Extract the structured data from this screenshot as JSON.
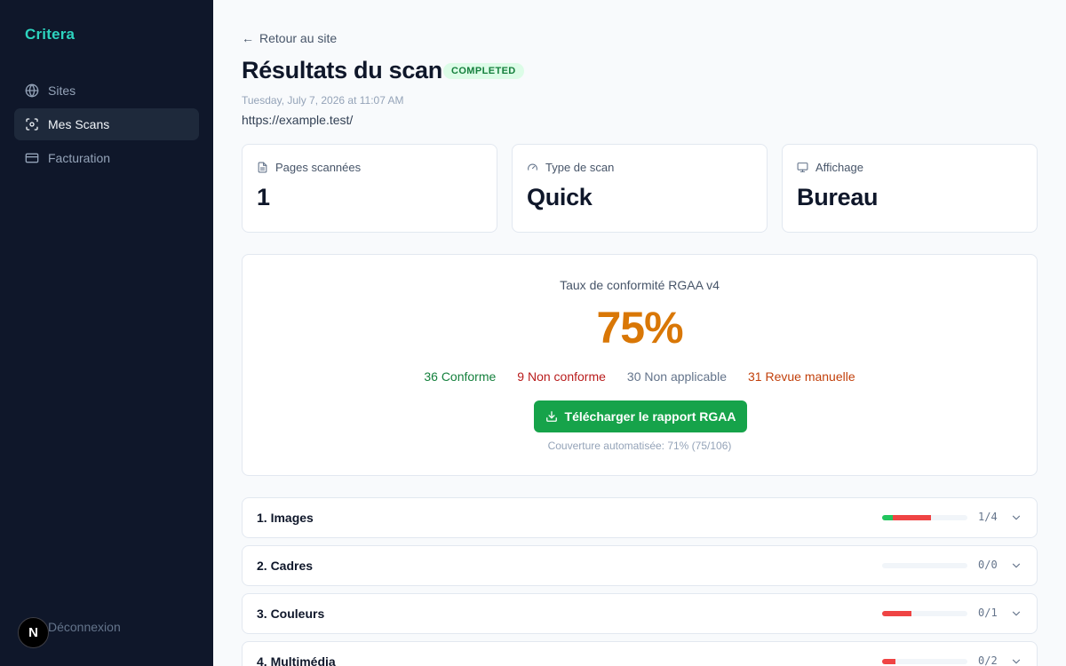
{
  "sidebar": {
    "brand": "Critera",
    "items": [
      {
        "label": "Sites",
        "icon": "globe-icon",
        "active": false
      },
      {
        "label": "Mes Scans",
        "icon": "scan-icon",
        "active": true
      },
      {
        "label": "Facturation",
        "icon": "credit-card-icon",
        "active": false
      }
    ],
    "logout_label": "Déconnexion",
    "badge_letter": "N"
  },
  "header": {
    "back_label": "Retour au site",
    "title": "Résultats du scan",
    "status": "COMPLETED",
    "date": "Tuesday, July 7, 2026 at 11:07 AM",
    "url": "https://example.test/"
  },
  "stats": [
    {
      "label": "Pages scannées",
      "value": "1",
      "icon": "file-icon"
    },
    {
      "label": "Type de scan",
      "value": "Quick",
      "icon": "gauge-icon"
    },
    {
      "label": "Affichage",
      "value": "Bureau",
      "icon": "monitor-icon"
    }
  ],
  "compliance": {
    "title": "Taux de conformité RGAA v4",
    "score": "75%",
    "conforme": "36 Conforme",
    "non_conforme": "9 Non conforme",
    "non_applicable": "30 Non applicable",
    "revue": "31 Revue manuelle",
    "download_label": "Télécharger le rapport RGAA",
    "coverage": "Couverture automatisée: 71% (75/106)"
  },
  "criteria": [
    {
      "name": "1. Images",
      "count": "1/4",
      "ok": 0.12,
      "ko": 0.45
    },
    {
      "name": "2. Cadres",
      "count": "0/0",
      "ok": 0,
      "ko": 0
    },
    {
      "name": "3. Couleurs",
      "count": "0/1",
      "ok": 0,
      "ko": 0.34
    },
    {
      "name": "4. Multimédia",
      "count": "0/2",
      "ok": 0,
      "ko": 0.16
    }
  ],
  "colors": {
    "sidebar_bg": "#0f172a",
    "brand": "#2dd4bf",
    "status_green": "#15803d",
    "score_orange": "#d97706",
    "button_green": "#16a34a",
    "bar_ok": "#22c55e",
    "bar_ko": "#ef4444"
  }
}
